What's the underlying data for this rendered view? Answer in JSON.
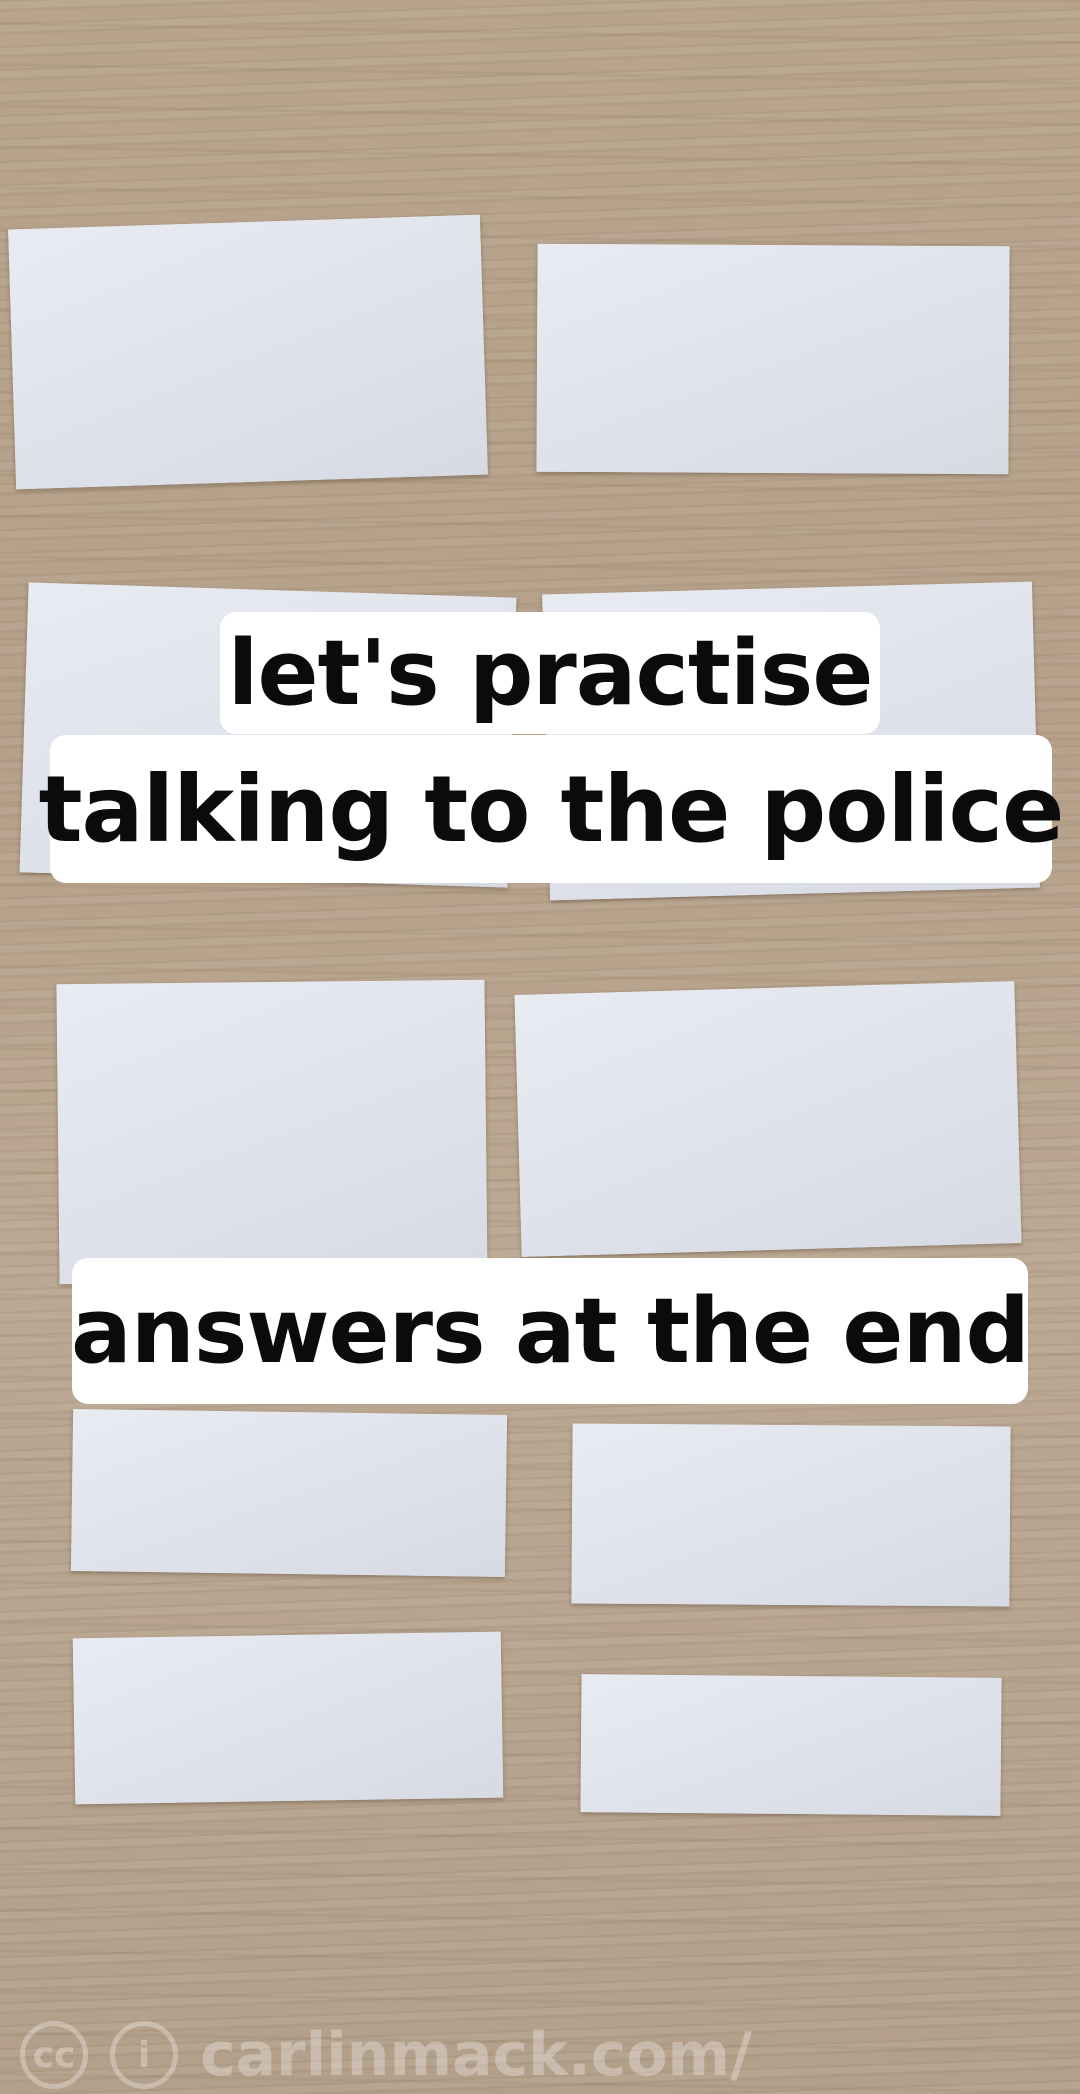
{
  "captions": {
    "line1": "let's practise",
    "line2": "talking to the police",
    "line3": "answers at the end"
  },
  "watermark": {
    "cc_symbol": "cc",
    "by_symbol": "i",
    "site": "carlinmack.com/"
  },
  "colors": {
    "caption_bg": "#ffffff",
    "caption_text": "#0b0b0b",
    "card": "#e2e5ec",
    "wood": "#b8a48c"
  }
}
